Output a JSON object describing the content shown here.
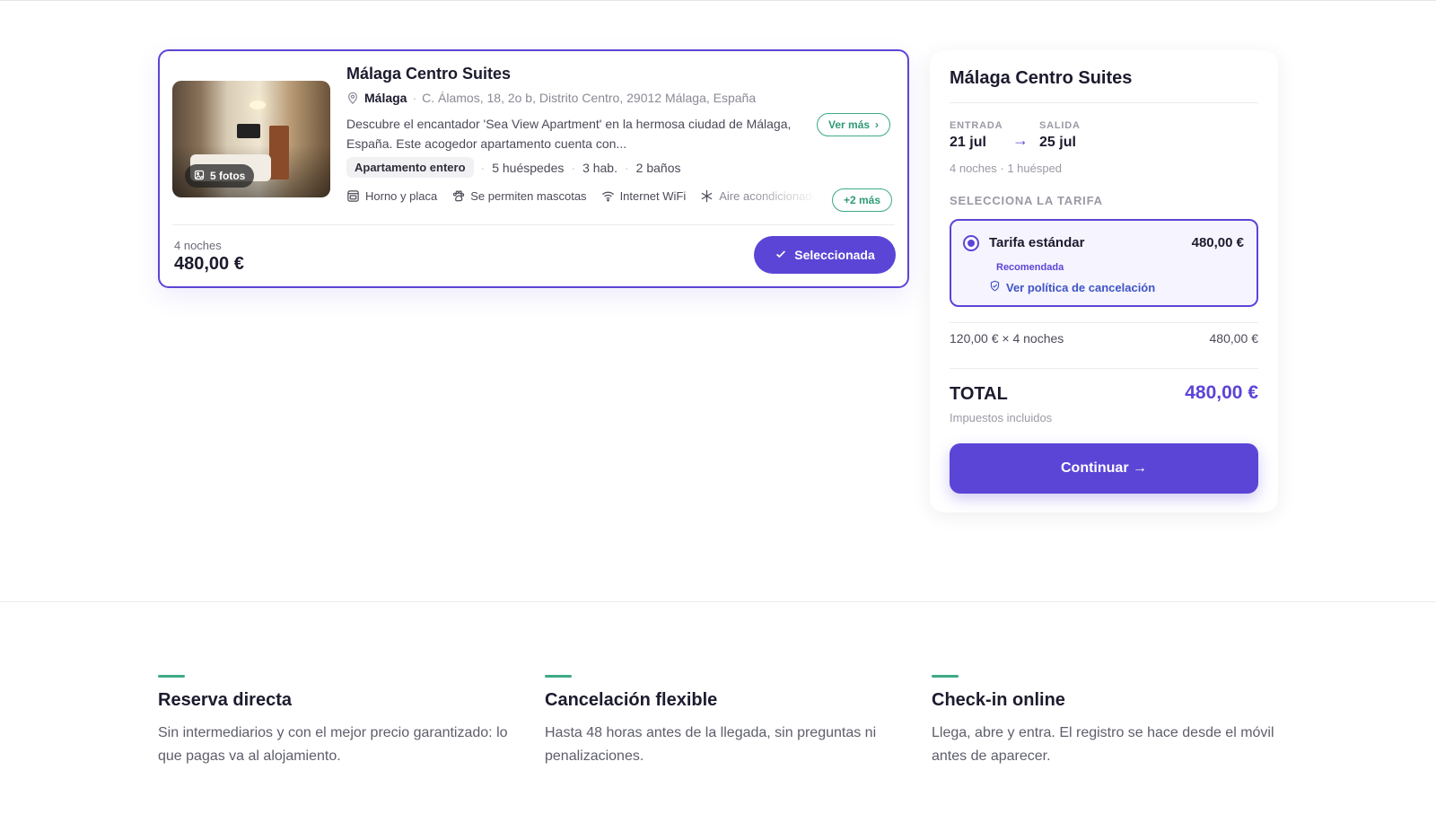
{
  "listing": {
    "photo_badge": "5 fotos",
    "name": "Málaga Centro Suites",
    "city": "Málaga",
    "address": "C. Álamos, 18, 2o b, Distrito Centro, 29012 Málaga, España",
    "description": "Descubre el encantador 'Sea View Apartment' en la hermosa ciudad de Málaga, España. Este acogedor apartamento cuenta con...",
    "see_more": "Ver más",
    "type": "Apartamento entero",
    "guests": "5 huéspedes",
    "rooms": "3 hab.",
    "baths": "2 baños",
    "amenities": [
      "Horno y placa",
      "Se permiten mascotas",
      "Internet WiFi",
      "Aire acondicionado"
    ],
    "more_amenities": "+2 más",
    "nights": "4 noches",
    "price": "480,00 €",
    "selected_label": "Seleccionada"
  },
  "booking": {
    "title": "Málaga Centro Suites",
    "checkin_label": "ENTRADA",
    "checkin_date": "21 jul",
    "checkout_label": "SALIDA",
    "checkout_date": "25 jul",
    "stay_summary": "4 noches · 1 huésped",
    "select_rate_label": "SELECCIONA LA TARIFA",
    "rate": {
      "name": "Tarifa estándar",
      "price": "480,00 €",
      "tag": "Recomendada",
      "policy_link": "Ver política de cancelación"
    },
    "line_item_label": "120,00 € × 4 noches",
    "line_item_value": "480,00 €",
    "total_label": "TOTAL",
    "total_value": "480,00 €",
    "tax_note": "Impuestos incluidos",
    "continue_label": "Continuar →"
  },
  "features": [
    {
      "title": "Reserva directa",
      "text": "Sin intermediarios y con el mejor precio garantizado: lo que pagas va al alojamiento."
    },
    {
      "title": "Cancelación flexible",
      "text": "Hasta 48 horas antes de la llegada, sin preguntas ni penalizaciones."
    },
    {
      "title": "Check-in online",
      "text": "Llega, abre y entra. El registro se hace desde el móvil antes de aparecer."
    }
  ],
  "colors": {
    "accent": "#5b45d6",
    "green": "#3daa86",
    "text": "#1c1b2e"
  }
}
